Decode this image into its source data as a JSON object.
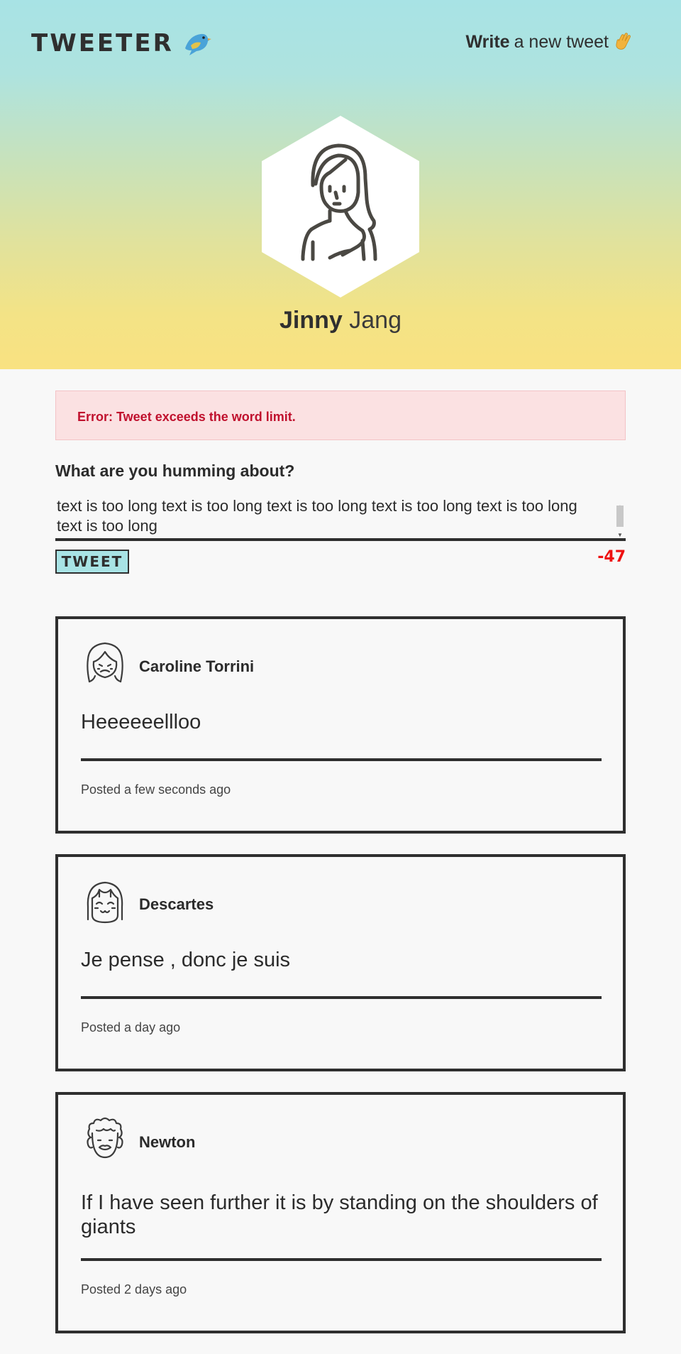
{
  "header": {
    "brand": "TWEETER",
    "write_bold": "Write",
    "write_rest": "a new tweet",
    "bird_icon": "bird-icon",
    "wave_icon": "waving-hand-icon"
  },
  "profile": {
    "first_name": "Jinny",
    "last_name": "Jang",
    "avatar_icon": "woman-avatar-icon"
  },
  "error": {
    "message": "Error: Tweet exceeds the word limit."
  },
  "compose": {
    "label": "What are you humming about?",
    "value": "text is too long text is too long text is too long text is too long text is too long\ntext is too long",
    "button_label": "TWEET",
    "counter": "-47"
  },
  "colors": {
    "accent": "#a8e3e5",
    "header_bottom": "#f9e281",
    "error_bg": "#fbe1e2",
    "error_text": "#c0112e",
    "counter_red": "#ee1111",
    "dark": "#2f2f2f"
  },
  "tweets": [
    {
      "author": "Caroline Torrini",
      "text": "Heeeeeellloo",
      "time": "Posted a few seconds ago",
      "avatar_icon": "girl-avatar-icon"
    },
    {
      "author": "Descartes",
      "text": "Je pense , donc je suis",
      "time": "Posted a day ago",
      "avatar_icon": "bangs-girl-avatar-icon"
    },
    {
      "author": "Newton",
      "text": "If I have seen further it is by standing on the shoulders of giants",
      "time": "Posted 2 days ago",
      "avatar_icon": "curly-hair-avatar-icon"
    }
  ]
}
